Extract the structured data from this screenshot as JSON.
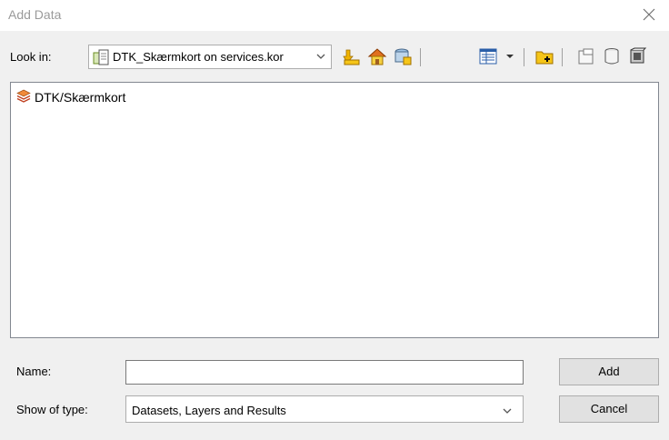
{
  "window": {
    "title": "Add Data"
  },
  "toolbar": {
    "lookin_label": "Look in:",
    "lookin_value": "DTK_Skærmkort on services.kor",
    "icons": [
      "up-one-level-icon",
      "home-icon",
      "connect-folder-icon",
      "view-list-icon",
      "view-dropdown-icon",
      "new-folder-icon",
      "new-geodatabase-icon",
      "new-database-icon",
      "catalog-icon"
    ]
  },
  "list": {
    "items": [
      {
        "label": "DTK/Skærmkort",
        "icon": "map-service-layer-icon"
      }
    ]
  },
  "form": {
    "name_label": "Name:",
    "name_value": "",
    "type_label": "Show of type:",
    "type_value": "Datasets, Layers and Results"
  },
  "buttons": {
    "add": "Add",
    "cancel": "Cancel"
  },
  "colors": {
    "title_gray": "#9a9a9a",
    "dialog_bg": "#f0f0f0",
    "button_bg": "#e1e1e1"
  }
}
